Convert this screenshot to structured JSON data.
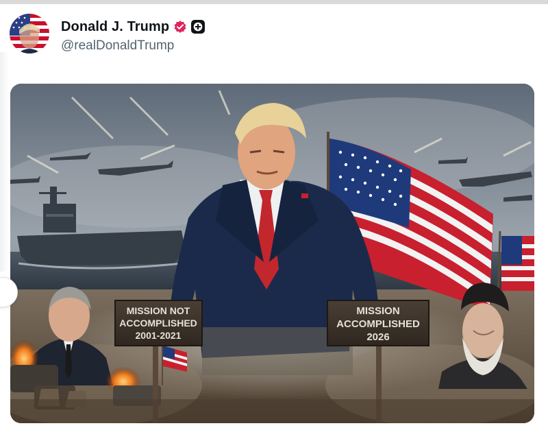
{
  "post": {
    "author": {
      "display_name": "Donald J. Trump",
      "handle": "@realDonaldTrump",
      "avatar_icon": "avatar-flag-portrait",
      "verified_icon": "verified-badge-icon",
      "affiliate_icon": "plus-badge-icon",
      "verified_color": "#e0245e"
    },
    "media": {
      "signs": [
        {
          "lines": [
            "MISSION NOT",
            "ACCOMPLISHED",
            "2001-2021"
          ]
        },
        {
          "lines": [
            "MISSION",
            "ACCOMPLISHED",
            "2026"
          ]
        }
      ]
    }
  },
  "colors": {
    "name": "#0f1419",
    "handle": "#536471",
    "sky": "#6f7b86",
    "ground": "#6b5a48"
  }
}
